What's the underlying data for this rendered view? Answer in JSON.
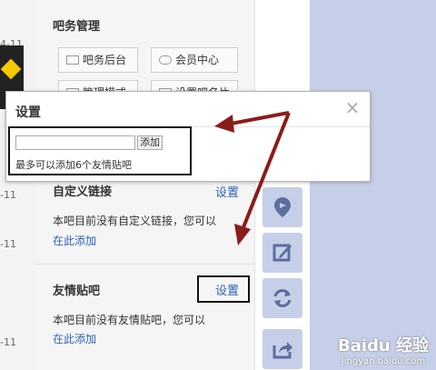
{
  "left": {
    "dates": [
      "4-11",
      "-11",
      "-11",
      "-11"
    ]
  },
  "sidebar": {
    "admin_title": "吧务管理",
    "buttons": [
      {
        "label": "吧务后台",
        "icon": "folder-icon"
      },
      {
        "label": "会员中心",
        "icon": "users-icon"
      },
      {
        "label": "管理模式",
        "icon": "settings-icon"
      },
      {
        "label": "设置吧名片",
        "icon": "card-icon"
      }
    ],
    "custom_links": {
      "title": "自定义链接",
      "setting_label": "设置",
      "empty_text": "本吧目前没有自定义链接，您可以",
      "add_link": "在此添加"
    },
    "friend_bars": {
      "title": "友情贴吧",
      "setting_label": "设置",
      "empty_text": "本吧目前没有友情贴吧，您可以",
      "add_link": "在此添加"
    }
  },
  "dialog": {
    "title": "设置",
    "input_value": "",
    "add_button": "添加",
    "note": "最多可以添加6个友情贴吧"
  },
  "watermark": {
    "logo": "Baidu 经验",
    "url": "jingyan.baidu.com"
  },
  "colors": {
    "accent_link": "#2d64b3",
    "arrow": "#8b1c1c",
    "side_blue": "#c6cfe8",
    "icon_blue": "#5b6e9e"
  }
}
